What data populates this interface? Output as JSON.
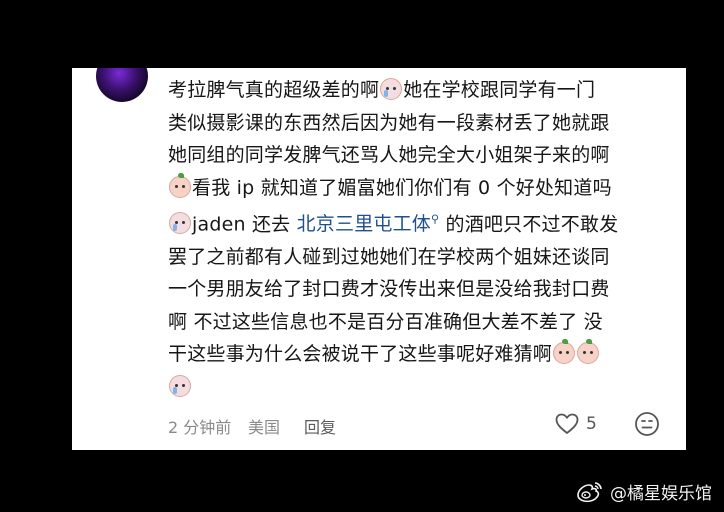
{
  "comment": {
    "lines": [
      "考拉脾气真的超级差的啊",
      "她在学校跟同学有一门",
      "类似摄影课的东西然后因为她有一段素材丢了她就跟",
      "她同组的同学发脾气还骂人她完全大小姐架子来的啊",
      "看我 ip 就知道了媚富她们你们有 0 个好处知道吗",
      "jaden 还去",
      "北京三里屯工体",
      "的酒吧只不过不敢发",
      "罢了之前都有人碰到过她她们在学校两个姐妹还谈同",
      "一个男朋友给了封口费才没传出来但是没给我封口费",
      "啊 不过这些信息也不是百分百准确但大差不差了 没",
      "干这些事为什么会被说干了这些事呢好难猜啊"
    ],
    "emojis": [
      "cry-emoji",
      "peach-emoji",
      "cry-emoji",
      "peach-emoji",
      "peach-emoji",
      "cry-emoji"
    ]
  },
  "footer": {
    "time": "2 分钟前",
    "location": "美国",
    "reply_label": "回复",
    "like_count": "5"
  },
  "watermark": {
    "text": "@橘星娱乐馆",
    "icon": "weibo-icon"
  }
}
